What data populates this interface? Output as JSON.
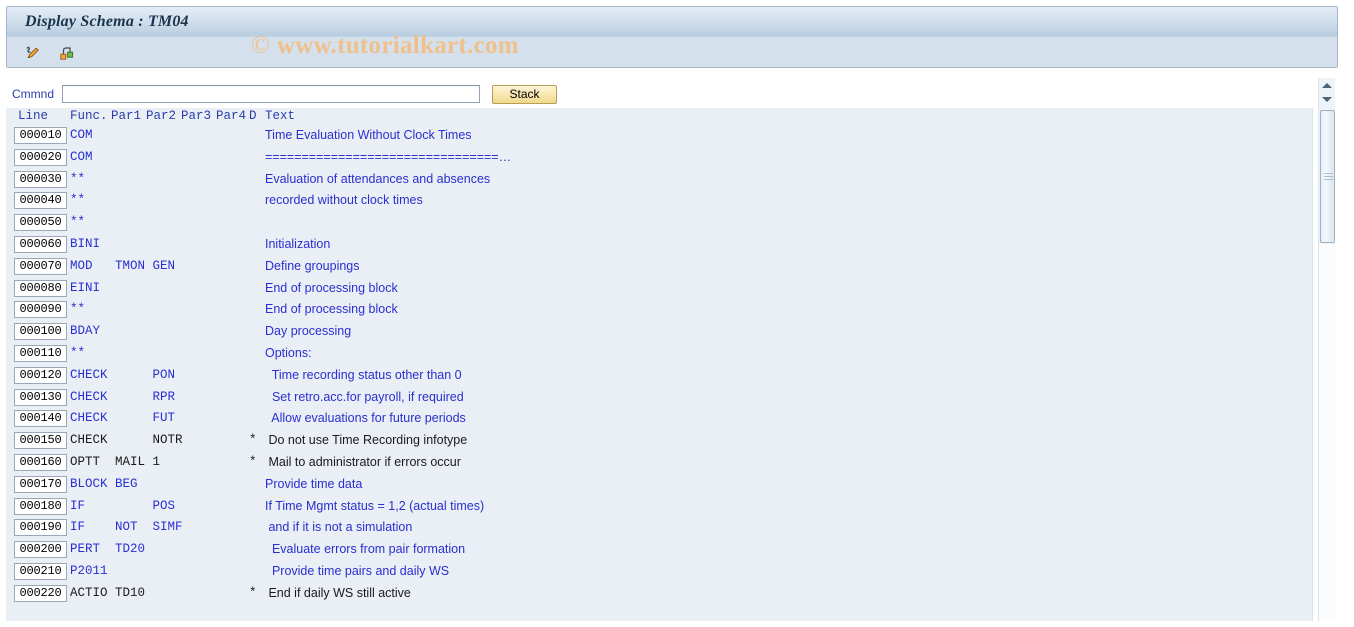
{
  "window": {
    "title": "Display Schema : TM04"
  },
  "watermark": {
    "copyright": "©",
    "text": "www.tutorialkart.com",
    "color": "#f0c08c"
  },
  "toolbar": {
    "buttons": [
      {
        "name": "display-change-icon",
        "label": "Display <-> Change",
        "icon": "pencil-icon"
      },
      {
        "name": "structure-icon",
        "label": "Structure",
        "icon": "hierarchy-icon"
      }
    ]
  },
  "command": {
    "label": "Cmmnd",
    "value": "",
    "placeholder": "",
    "stack_label": "Stack"
  },
  "grid": {
    "headers": {
      "line": "Line",
      "func": "Func.",
      "par1": "Par1",
      "par2": "Par2",
      "par3": "Par3",
      "par4": "Par4",
      "d": "D",
      "text": "Text"
    },
    "rows": [
      {
        "line": "000010",
        "code": "COM",
        "d": "",
        "text": "Time Evaluation Without Clock Times",
        "deactivated": false
      },
      {
        "line": "000020",
        "code": "COM",
        "d": "",
        "text": "================================…",
        "deactivated": false
      },
      {
        "line": "000030",
        "code": "**",
        "d": "",
        "text": "Evaluation of attendances and absences",
        "deactivated": false
      },
      {
        "line": "000040",
        "code": "**",
        "d": "",
        "text": "recorded without clock times",
        "deactivated": false
      },
      {
        "line": "000050",
        "code": "**",
        "d": "",
        "text": "",
        "deactivated": false
      },
      {
        "line": "000060",
        "code": "BINI",
        "d": "",
        "text": "Initialization",
        "deactivated": false
      },
      {
        "line": "000070",
        "code": "MOD   TMON GEN",
        "d": "",
        "text": "Define groupings",
        "deactivated": false
      },
      {
        "line": "000080",
        "code": "EINI",
        "d": "",
        "text": "End of processing block",
        "deactivated": false
      },
      {
        "line": "000090",
        "code": "**",
        "d": "",
        "text": "End of processing block",
        "deactivated": false
      },
      {
        "line": "000100",
        "code": "BDAY",
        "d": "",
        "text": "Day processing",
        "deactivated": false
      },
      {
        "line": "000110",
        "code": "**",
        "d": "",
        "text": "Options:",
        "deactivated": false
      },
      {
        "line": "000120",
        "code": "CHECK      PON",
        "d": "",
        "text": "  Time recording status other than 0",
        "deactivated": false
      },
      {
        "line": "000130",
        "code": "CHECK      RPR",
        "d": "",
        "text": "  Set retro.acc.for payroll, if required",
        "deactivated": false
      },
      {
        "line": "000140",
        "code": "CHECK      FUT",
        "d": "",
        "text": "  Allow evaluations for future periods",
        "deactivated": false
      },
      {
        "line": "000150",
        "code": "CHECK      NOTR",
        "d": "*",
        "text": " Do not use Time Recording infotype",
        "deactivated": true
      },
      {
        "line": "000160",
        "code": "OPTT  MAIL 1",
        "d": "*",
        "text": " Mail to administrator if errors occur",
        "deactivated": true
      },
      {
        "line": "000170",
        "code": "BLOCK BEG",
        "d": "",
        "text": "Provide time data",
        "deactivated": false
      },
      {
        "line": "000180",
        "code": "IF         POS",
        "d": "",
        "text": "If Time Mgmt status = 1,2 (actual times)",
        "deactivated": false
      },
      {
        "line": "000190",
        "code": "IF    NOT  SIMF",
        "d": "",
        "text": " and if it is not a simulation",
        "deactivated": false
      },
      {
        "line": "000200",
        "code": "PERT  TD20",
        "d": "",
        "text": "  Evaluate errors from pair formation",
        "deactivated": false
      },
      {
        "line": "000210",
        "code": "P2011",
        "d": "",
        "text": "  Provide time pairs and daily WS",
        "deactivated": false
      },
      {
        "line": "000220",
        "code": "ACTIO TD10",
        "d": "*",
        "text": " End if daily WS still active",
        "deactivated": true
      }
    ]
  },
  "scrollbar": {
    "up_arrow": "▲",
    "down_arrow": "▼"
  }
}
